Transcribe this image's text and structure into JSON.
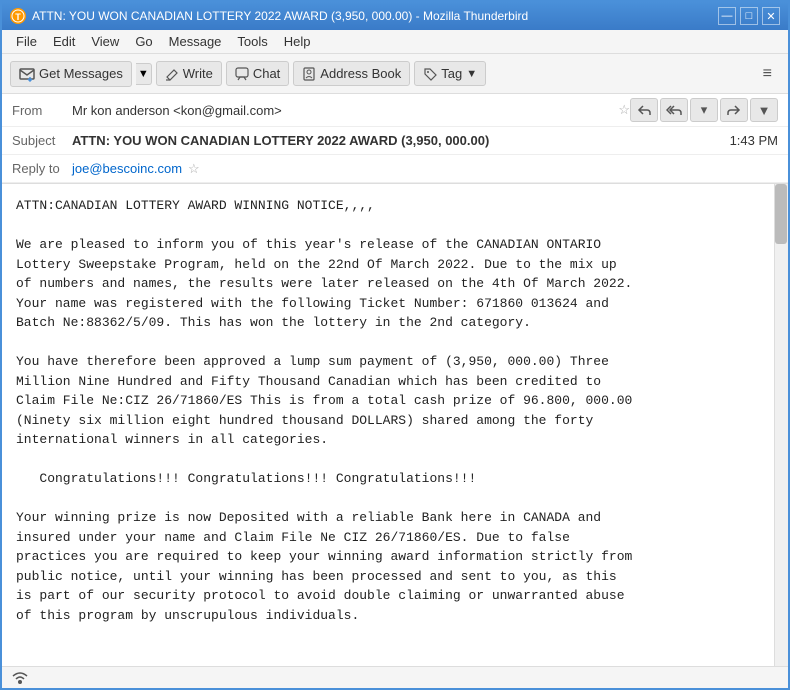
{
  "window": {
    "title": "ATTN: YOU WON CANADIAN LOTTERY 2022 AWARD (3,950, 000.00) - Mozilla Thunderbird",
    "app_name": "Mozilla Thunderbird"
  },
  "title_controls": {
    "minimize": "—",
    "maximize": "□",
    "close": "✕"
  },
  "menu": {
    "items": [
      "File",
      "Edit",
      "View",
      "Go",
      "Message",
      "Tools",
      "Help"
    ]
  },
  "toolbar": {
    "get_messages": "Get Messages",
    "write": "Write",
    "chat": "Chat",
    "address_book": "Address Book",
    "tag": "Tag"
  },
  "email": {
    "from_label": "From",
    "from_value": "Mr kon anderson <kon@gmail.com>",
    "subject_label": "Subject",
    "subject_value": "ATTN: YOU WON CANADIAN LOTTERY 2022 AWARD (3,950, 000.00)",
    "time": "1:43 PM",
    "reply_to_label": "Reply to",
    "reply_to_value": "joe@bescoinc.com",
    "body": "ATTN:CANADIAN LOTTERY AWARD WINNING NOTICE,,,,\n\nWe are pleased to inform you of this year's release of the CANADIAN ONTARIO\nLottery Sweepstake Program, held on the 22nd Of March 2022. Due to the mix up\nof numbers and names, the results were later released on the 4th Of March 2022.\nYour name was registered with the following Ticket Number: 671860 013624 and\nBatch Ne:88362/5/09. This has won the lottery in the 2nd category.\n\nYou have therefore been approved a lump sum payment of (3,950, 000.00) Three\nMillion Nine Hundred and Fifty Thousand Canadian which has been credited to\nClaim File Ne:CIZ 26/71860/ES This is from a total cash prize of 96.800, 000.00\n(Ninety six million eight hundred thousand DOLLARS) shared among the forty\ninternational winners in all categories.\n\n   Congratulations!!! Congratulations!!! Congratulations!!!\n\nYour winning prize is now Deposited with a reliable Bank here in CANADA and\ninsured under your name and Claim File Ne CIZ 26/71860/ES. Due to false\npractices you are required to keep your winning award information strictly from\npublic notice, until your winning has been processed and sent to you, as this\nis part of our security protocol to avoid double claiming or unwarranted abuse\nof this program by unscrupulous individuals."
  },
  "status_bar": {
    "icon": "📡"
  }
}
